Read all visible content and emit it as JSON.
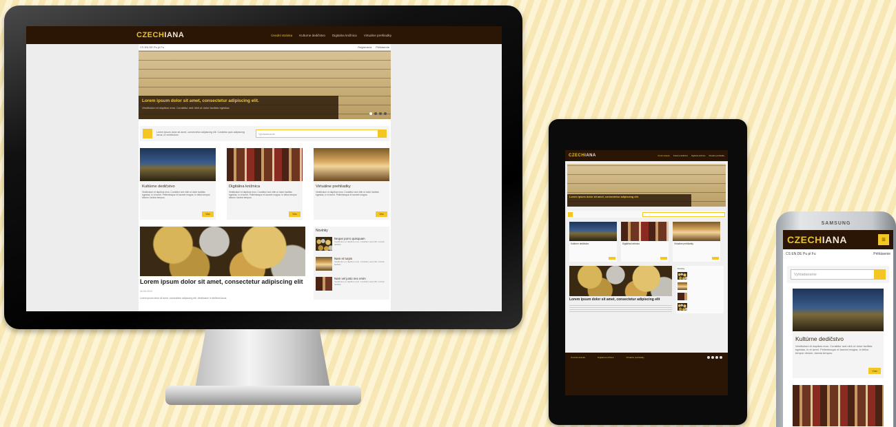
{
  "site": {
    "logo_part1": "CZECH",
    "logo_part2": "IANA",
    "nav": [
      "Úvodní stránka",
      "Kulturne dedičstvo",
      "Digitalna knižnica",
      "Virtuálne prehliadky"
    ],
    "topbar_left": "CS  EN  DE  Pu  pl  Fu",
    "topbar_right": [
      "Registrácia",
      "Prihlásenie"
    ],
    "hero_title": "Lorem ipsum dolor sit amet, consectetur adipiscing elit.",
    "hero_text": "Vestibulum et dapibus eros. Curabitur sed nibh ut dolor facilisis egestas.",
    "search_intro": "Lorem ipsum dolor sit amet, consectetur adipiscing elit. Curabitur quis adipiscing lacus, ut vestibulum.",
    "search_placeholder": "Vyhladavanie",
    "cards": [
      {
        "title": "Kultúrne dedičstvo",
        "text": "Vestibulum et dapibus eros. Curabitur sed nibh ut dolor facilisis egestas, in et amet. Pellentesque et laoreet magna. In tellus tempor dictum, lacinia tempus.",
        "button": "Viac"
      },
      {
        "title": "Digitálna knižnica",
        "text": "Vestibulum et dapibus eros. Curabitur sed nibh ut dolor facilisis egestas, in et amet. Pellentesque et laoreet magna. In tellus tempor dictum, lacinia tempus.",
        "button": "Viac"
      },
      {
        "title": "Virtuálne prehliadky",
        "text": "Vestibulum et dapibus eros. Curabitur sed nibh ut dolor facilisis egestas, in et amet. Pellentesque et laoreet magna.",
        "button": "Viac"
      }
    ],
    "article_title": "Lorem ipsum dolor sit amet, consectetur adipiscing elit",
    "article_date": "26.05.2013",
    "article_text": "Lorem ipsum dolor sit amet, consectetur adipiscing elit. Vestibulum in eleifend lacus.",
    "news_title": "Novinky",
    "news": [
      {
        "title": "Neque porro quisquam",
        "text": "Vestibulum et dapibus eros. Curabitur sed nibh ut dolor facilisis."
      },
      {
        "title": "Nam et turpis",
        "text": "Vestibulum et dapibus eros. Curabitur sed nibh ut dolor facilisis."
      },
      {
        "title": "Nam vel justo nec enim",
        "text": "Vestibulum et dapibus eros. Curabitur sed nibh ut dolor facilisis."
      }
    ],
    "footer_cols": [
      "Úvodná stránka",
      "Digitalna knižnica",
      "Virtuálne prehliadky"
    ]
  },
  "phone": {
    "brand": "SAMSUNG",
    "lang": "CS  EN  DE  Pu  pl  Fu",
    "login": "Prihlásenie",
    "search_placeholder": "Vyhladavanie",
    "card_title": "Kultúrne dedičstvo",
    "card_text": "Vestibulum et dapibus eros. Curabitur sed nibh ut dolor facilisis egestas, in et amet. Pellentesque et laoreet magna. In tellus tempor dictum, lacinia tempus.",
    "card_button": "Viac"
  },
  "colors": {
    "brand_dark": "#2b1606",
    "accent": "#f3c623",
    "background_stripe": "#f7e7b4"
  }
}
